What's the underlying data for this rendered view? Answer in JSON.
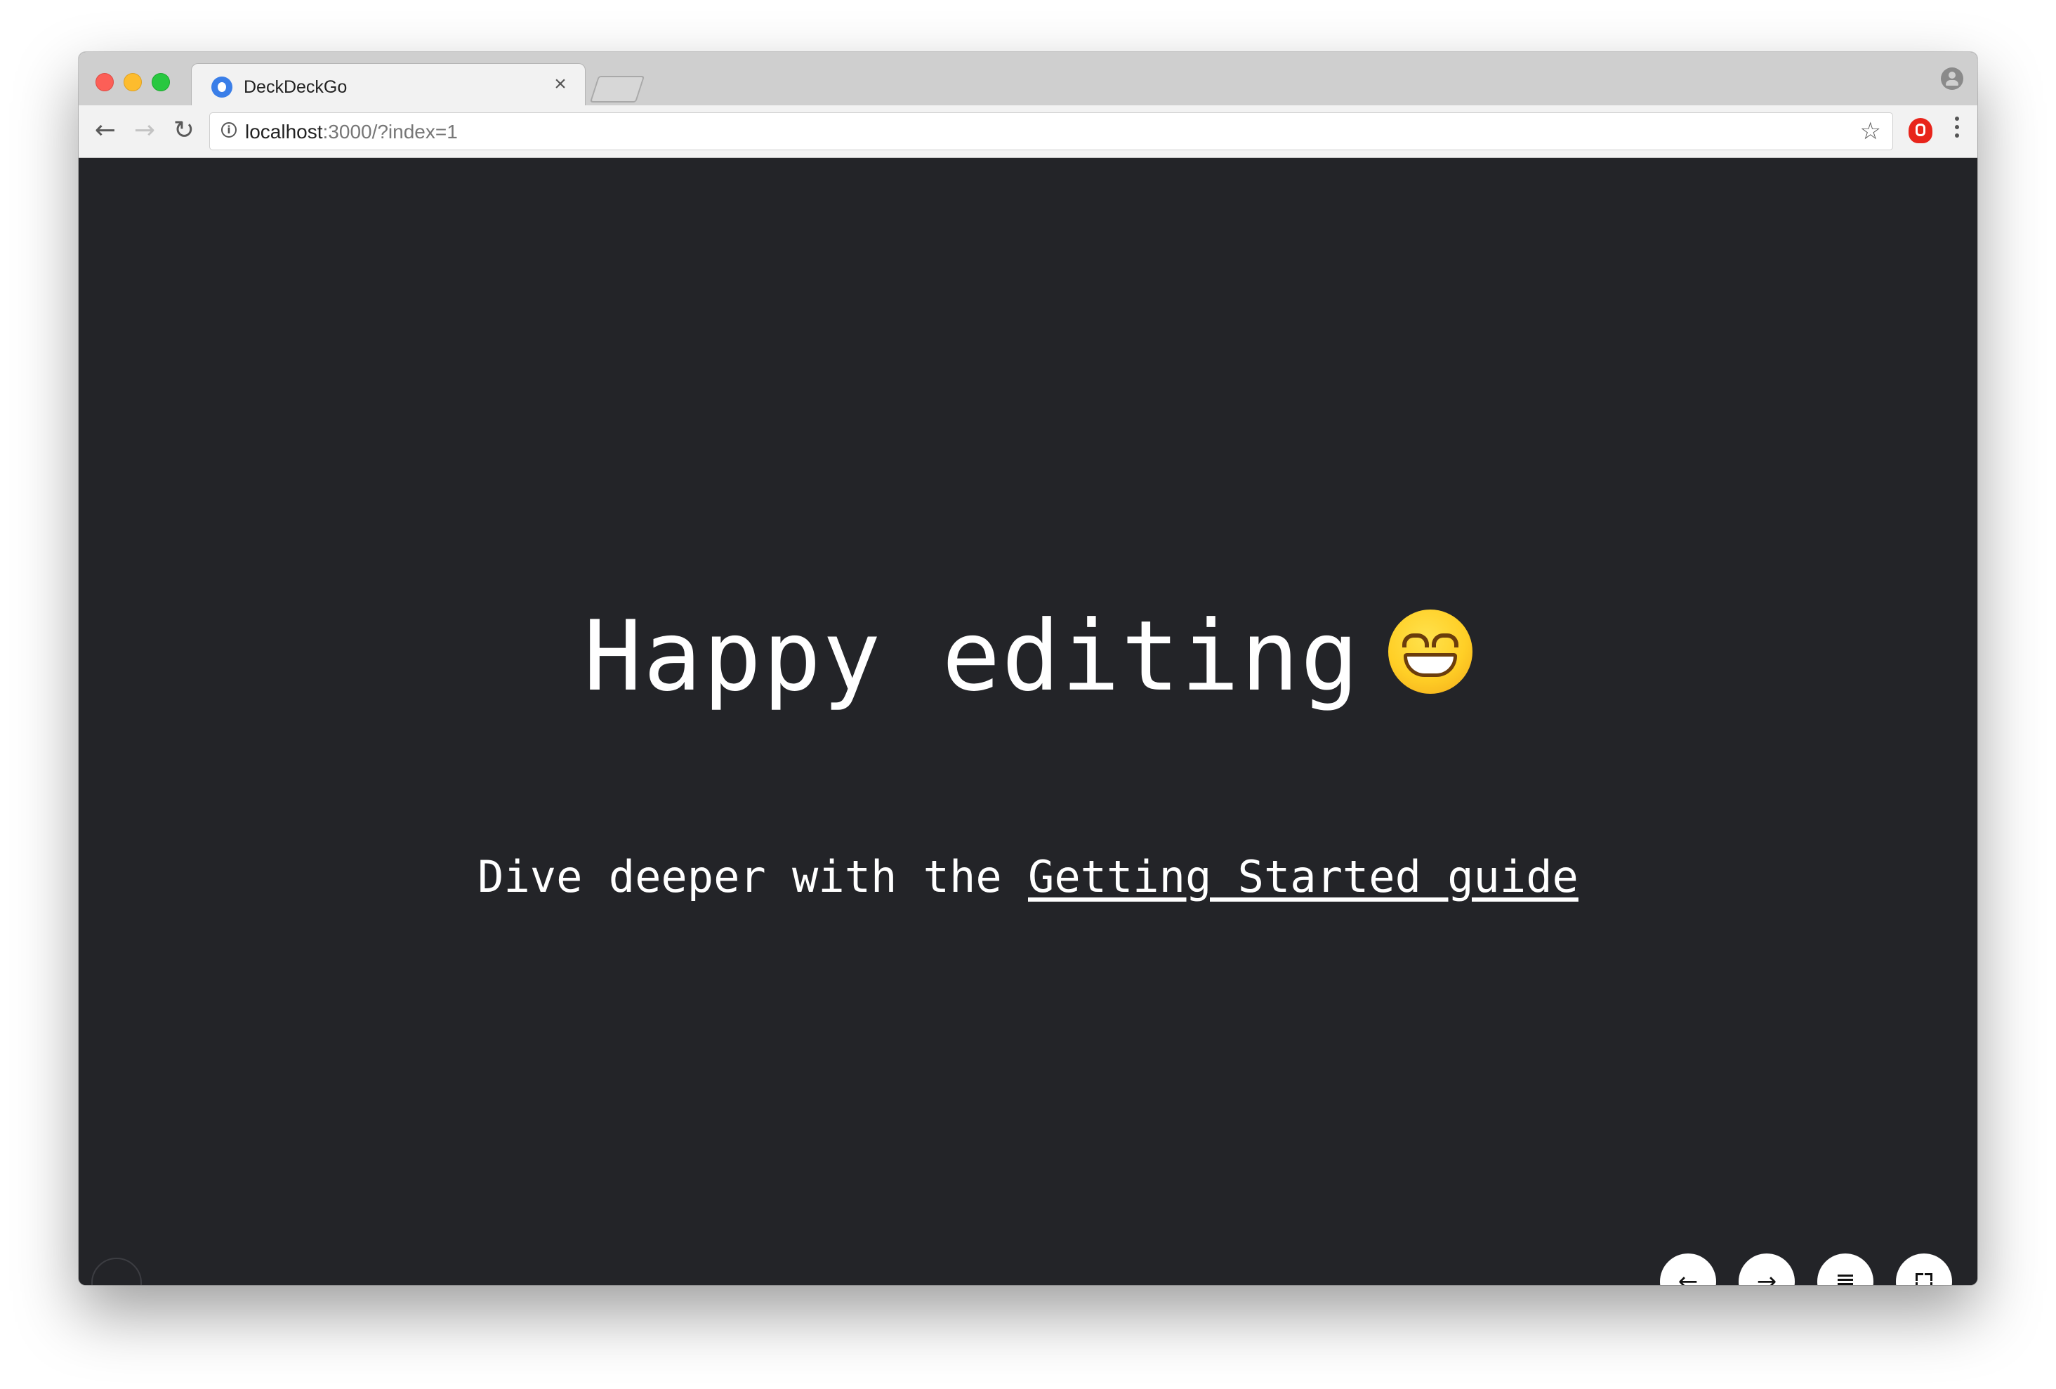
{
  "browser": {
    "tab": {
      "title": "DeckDeckGo",
      "close_glyph": "×"
    },
    "nav": {
      "back_glyph": "←",
      "forward_glyph": "→",
      "reload_glyph": "↻"
    },
    "address_bar": {
      "host": "localhost",
      "rest": ":3000/?index=1",
      "info_glyph": "i",
      "star_glyph": "☆"
    },
    "icons": [
      "deckdeckgo-favicon",
      "profile-icon",
      "info-icon",
      "bookmark-star-icon",
      "extension-icon",
      "menu-icon"
    ]
  },
  "slide": {
    "title": "Happy editing",
    "title_emoji": "grinning-face-with-smiling-eyes",
    "subtitle_prefix": "Dive deeper with the ",
    "subtitle_link": "Getting Started guide",
    "background_color": "#232428",
    "text_color": "#ffffff"
  },
  "controls": {
    "prev_glyph": "←",
    "next_glyph": "→",
    "notes_icon": "notes-icon",
    "fullscreen_icon": "fullscreen-icon"
  }
}
